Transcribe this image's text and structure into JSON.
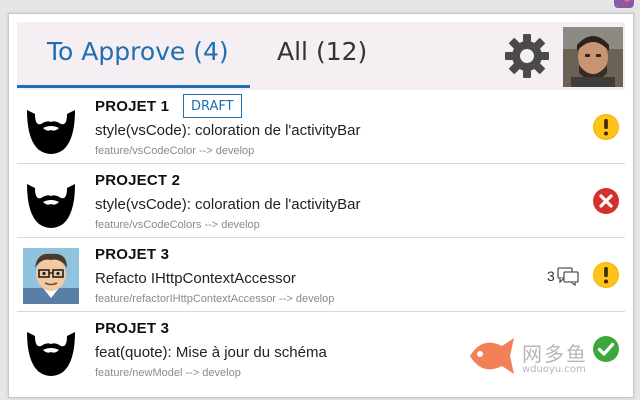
{
  "header": {
    "tab_approve": "To Approve (4)",
    "tab_all": "All (12)",
    "accent": "#1f6fb2"
  },
  "rows": [
    {
      "project": "PROJET 1",
      "badge": "DRAFT",
      "title": "style(vsCode): coloration de l'activityBar",
      "branch": "feature/vsCodeColor --> develop",
      "avatar": "beard-icon",
      "status": "warning-icon"
    },
    {
      "project": "PROJECT 2",
      "title": "style(vsCode): coloration de l'activityBar",
      "branch": "feature/vsCodeColors --> develop",
      "avatar": "beard-icon",
      "status": "error-icon"
    },
    {
      "project": "PROJET 3",
      "title": "Refacto IHttpContextAccessor",
      "branch": "feature/refactorIHttpContextAccessor --> develop",
      "avatar": "cartoon-avatar",
      "comments": "3",
      "status": "warning-icon"
    },
    {
      "project": "PROJET 3",
      "title": "feat(quote): Mise à jour du schéma",
      "branch": "feature/newModel --> develop",
      "avatar": "beard-icon",
      "status": "success-icon"
    }
  ],
  "watermark": {
    "text": "网多鱼",
    "url": "wduoyu.com"
  }
}
